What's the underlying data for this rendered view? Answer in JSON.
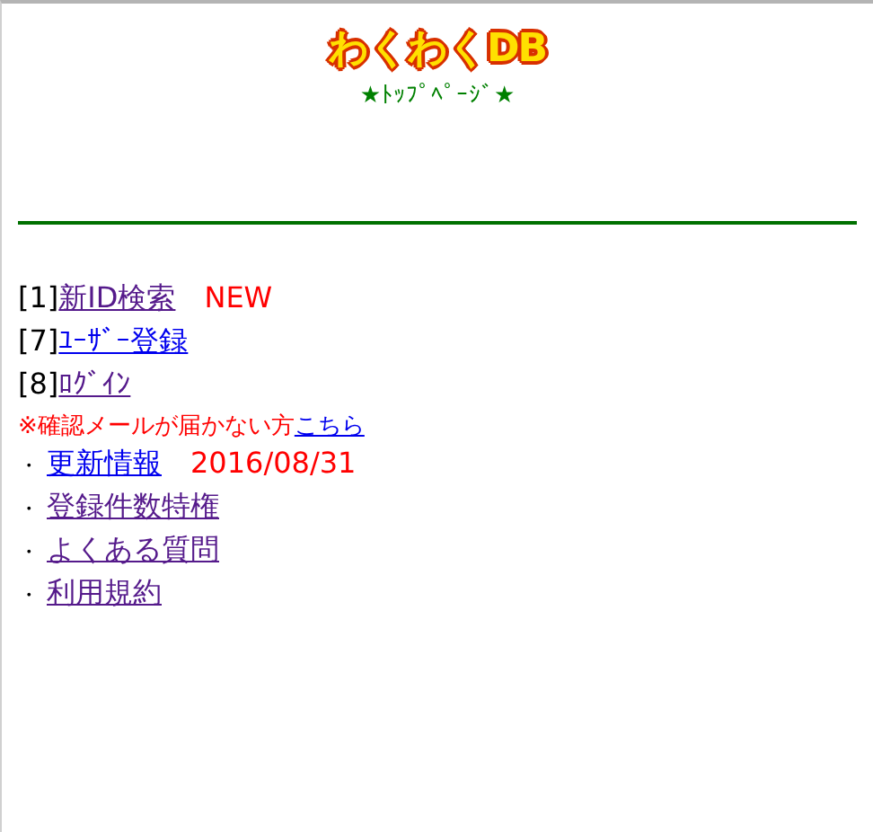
{
  "header": {
    "logo": "わくわくDB",
    "subtitle": "★ﾄｯﾌﾟﾍﾟｰｼﾞ★"
  },
  "menu": [
    {
      "kind": "numbered",
      "prefix": "[1]",
      "link": "新ID検索",
      "visited": true,
      "note": "NEW"
    },
    {
      "kind": "numbered",
      "prefix": "[7]",
      "link": "ﾕｰｻﾞｰ登録",
      "visited": false
    },
    {
      "kind": "numbered",
      "prefix": "[8]",
      "link": "ﾛｸﾞｲﾝ",
      "visited": true
    },
    {
      "kind": "notice",
      "prefix": "※確認メールが届かない方",
      "link": "こちら",
      "visited": false
    },
    {
      "kind": "bullet",
      "prefix": "・",
      "link": "更新情報",
      "visited": false,
      "note": "2016/08/31"
    },
    {
      "kind": "bullet",
      "prefix": "・",
      "link": "登録件数特権",
      "visited": true
    },
    {
      "kind": "bullet",
      "prefix": "・",
      "link": "よくある質問",
      "visited": true
    },
    {
      "kind": "bullet",
      "prefix": "・",
      "link": "利用規約",
      "visited": true
    }
  ]
}
